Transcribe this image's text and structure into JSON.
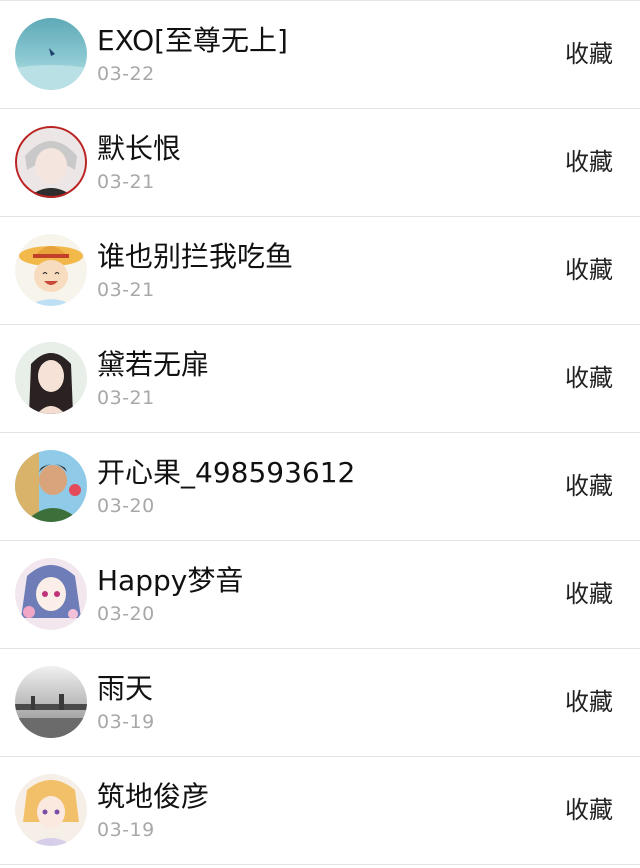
{
  "items": [
    {
      "name": "EXO[至尊无上]",
      "date": "03-22",
      "action": "收藏"
    },
    {
      "name": "默长恨",
      "date": "03-21",
      "action": "收藏"
    },
    {
      "name": "谁也别拦我吃鱼",
      "date": "03-21",
      "action": "收藏"
    },
    {
      "name": "黛若无扉",
      "date": "03-21",
      "action": "收藏"
    },
    {
      "name": "开心果_498593612",
      "date": "03-20",
      "action": "收藏"
    },
    {
      "name": "Happy梦音",
      "date": "03-20",
      "action": "收藏"
    },
    {
      "name": "雨天",
      "date": "03-19",
      "action": "收藏"
    },
    {
      "name": "筑地俊彦",
      "date": "03-19",
      "action": "收藏"
    }
  ]
}
